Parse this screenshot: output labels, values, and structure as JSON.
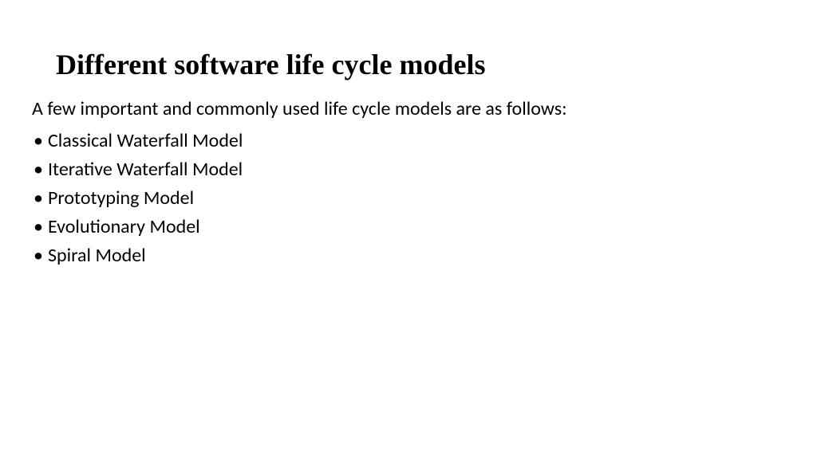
{
  "title": "Different software life cycle models",
  "intro": "A few important and commonly used life cycle models are as follows:",
  "items": [
    "Classical Waterfall Model",
    "Iterative Waterfall Model",
    "Prototyping Model",
    "Evolutionary Model",
    "Spiral Model"
  ]
}
